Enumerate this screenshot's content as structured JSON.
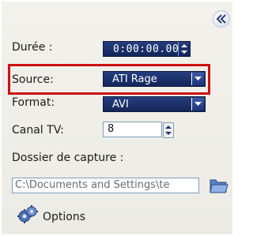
{
  "collapse": {
    "icon": "double-chevron-left-icon"
  },
  "fields": {
    "duration": {
      "label": "Durée :",
      "value": "0:00:00.00"
    },
    "source": {
      "label": "Source:",
      "value": "ATI Rage"
    },
    "format": {
      "label": "Format:",
      "value": "AVI"
    },
    "tv_channel": {
      "label": "Canal TV:",
      "value": "8"
    },
    "capture_folder": {
      "label": "Dossier de capture :",
      "value": "C:\\Documents and Settings\\te"
    }
  },
  "options": {
    "label": "Options",
    "icon": "gears-icon"
  },
  "colors": {
    "field_bg": "#1c3266",
    "highlight": "#cc1010",
    "panel_bg": "#eeede7"
  }
}
